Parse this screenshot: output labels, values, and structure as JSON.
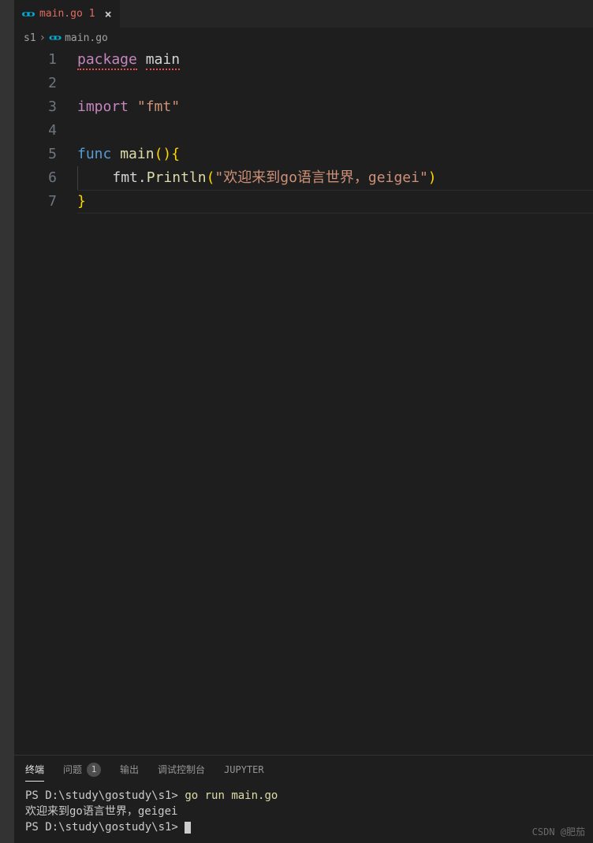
{
  "tab": {
    "filename": "main.go",
    "modified_indicator": "1",
    "close_label": "×"
  },
  "breadcrumbs": {
    "folder": "s1",
    "separator": "›",
    "file": "main.go"
  },
  "gutter": {
    "lines": [
      "1",
      "2",
      "3",
      "4",
      "5",
      "6",
      "7"
    ]
  },
  "code": {
    "l1_kw": "package",
    "l1_name": "main",
    "l3_kw": "import",
    "l3_str": "\"fmt\"",
    "l5_func": "func",
    "l5_name": "main",
    "l5_open": "()",
    "l5_brace": "{",
    "l6_pkg": "fmt",
    "l6_dot": ".",
    "l6_call": "Println",
    "l6_lp": "(",
    "l6_str": "\"欢迎来到go语言世界，geigei\"",
    "l6_rp": ")",
    "l7_brace": "}"
  },
  "panel": {
    "tabs": {
      "terminal": "终端",
      "problems": "问题",
      "problems_count": "1",
      "output": "输出",
      "debug": "调试控制台",
      "jupyter": "JUPYTER"
    },
    "terminal": {
      "line1_prompt": "PS D:\\study\\gostudy\\s1>",
      "line1_cmd": "go run main.go",
      "line2": "欢迎来到go语言世界，geigei",
      "line3_prompt": "PS D:\\study\\gostudy\\s1>"
    }
  },
  "watermark": "CSDN @肥茄"
}
